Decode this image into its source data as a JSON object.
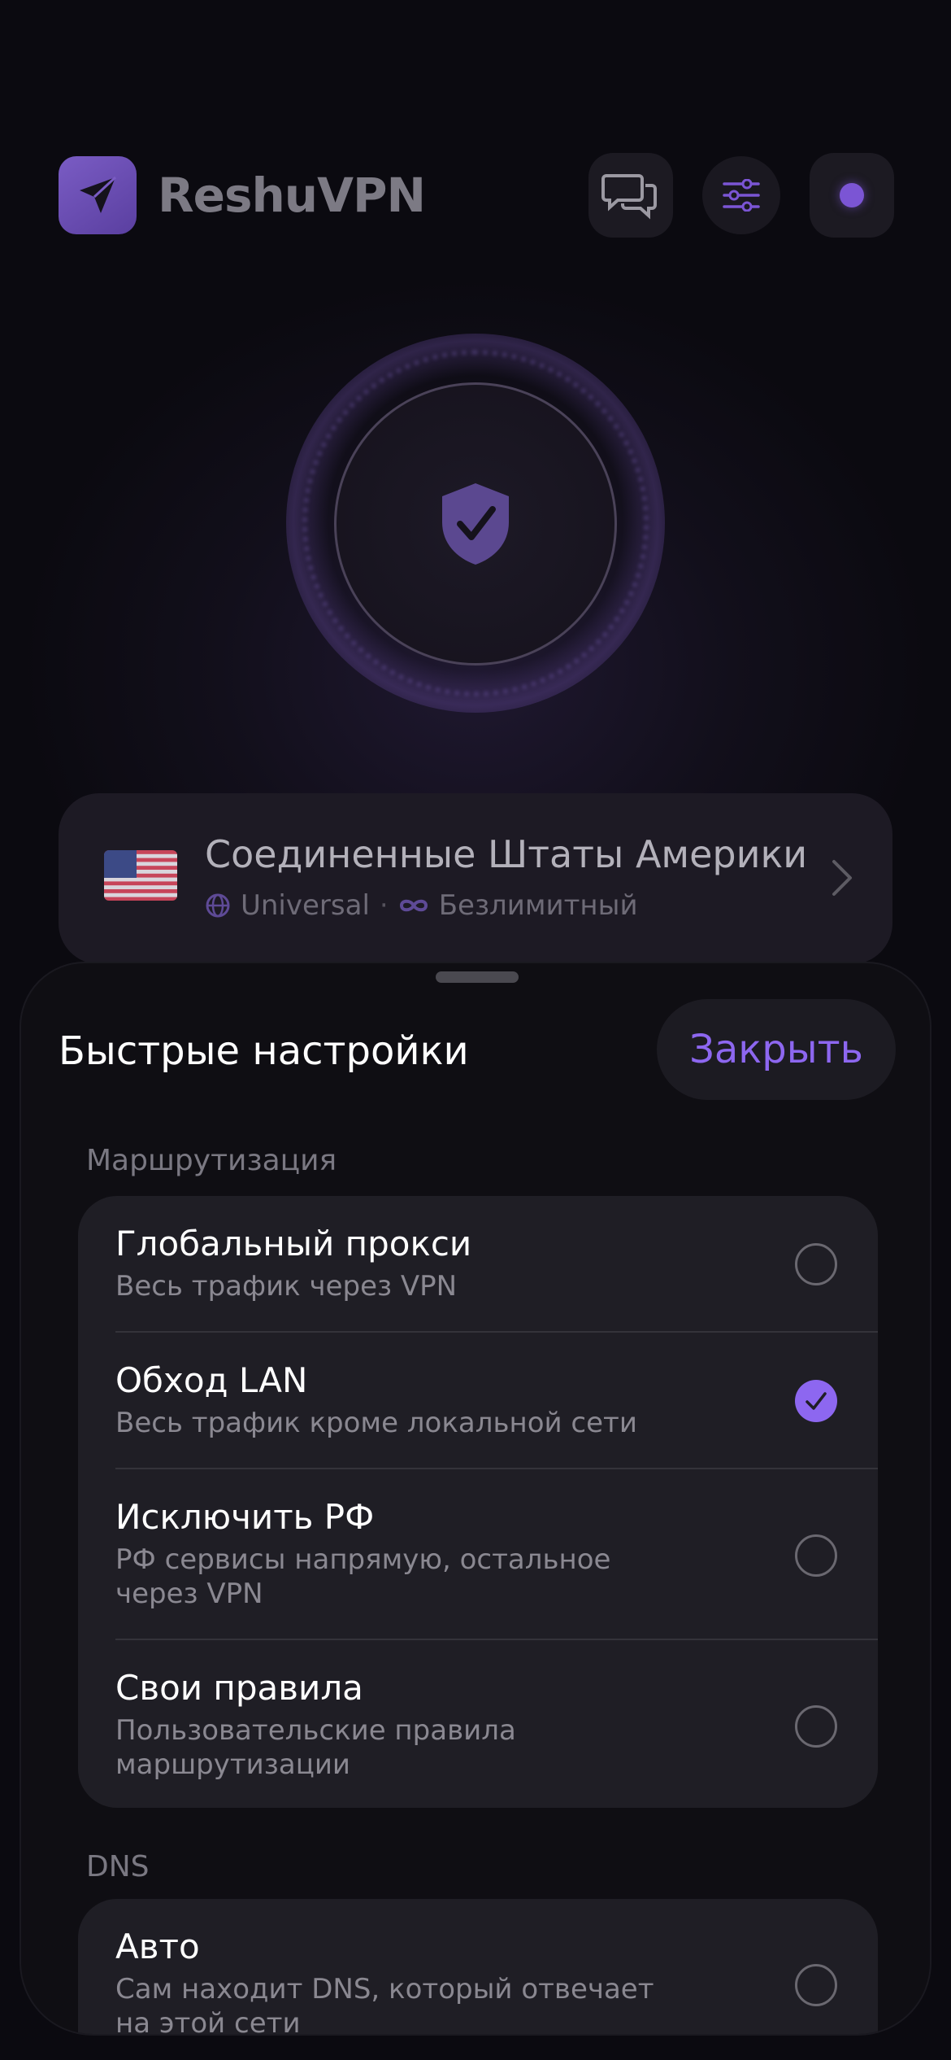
{
  "app": {
    "title": "ReshuVPN"
  },
  "header": {
    "icons": [
      "send-icon",
      "chat-icon",
      "sliders-icon",
      "status-dot"
    ],
    "accent": "#8d67f0"
  },
  "connect": {
    "state_icon": "shield-check-icon"
  },
  "server": {
    "country": "Соединенные Штаты Америки",
    "flag": "US",
    "protocol": "Universal",
    "separator": "·",
    "plan": "Безлимитный"
  },
  "sheet": {
    "title": "Быстрые настройки",
    "close_label": "Закрыть",
    "routing": {
      "label": "Маршрутизация",
      "options": [
        {
          "title": "Глобальный прокси",
          "subtitle": "Весь трафик через VPN",
          "selected": false
        },
        {
          "title": "Обход LAN",
          "subtitle": "Весь трафик кроме локальной сети",
          "selected": true
        },
        {
          "title": "Исключить РФ",
          "subtitle": "РФ сервисы напрямую, остальное через VPN",
          "selected": false
        },
        {
          "title": "Свои правила",
          "subtitle": "Пользовательские правила маршрутизации",
          "selected": false
        }
      ]
    },
    "dns": {
      "label": "DNS",
      "options": [
        {
          "title": "Авто",
          "subtitle": "Сам находит DNS, который отвечает на этой сети",
          "selected": false
        }
      ]
    }
  }
}
